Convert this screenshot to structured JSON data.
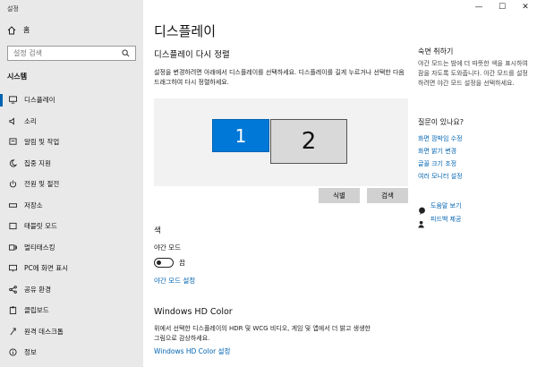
{
  "window": {
    "title": "설정",
    "controls": [
      "—",
      "☐",
      "✕"
    ]
  },
  "sidebar": {
    "home": "홈",
    "search_placeholder": "설정 검색",
    "section": "시스템",
    "items": [
      {
        "label": "디스플레이",
        "icon": "monitor-icon"
      },
      {
        "label": "소리",
        "icon": "speaker-icon"
      },
      {
        "label": "알림 및 작업",
        "icon": "notification-icon"
      },
      {
        "label": "집중 지원",
        "icon": "moon-icon"
      },
      {
        "label": "전원 및 절전",
        "icon": "power-icon"
      },
      {
        "label": "저장소",
        "icon": "storage-icon"
      },
      {
        "label": "태블릿 모드",
        "icon": "tablet-icon"
      },
      {
        "label": "멀티태스킹",
        "icon": "multitask-icon"
      },
      {
        "label": "PC에 화면 표시",
        "icon": "project-icon"
      },
      {
        "label": "공유 환경",
        "icon": "share-icon"
      },
      {
        "label": "클립보드",
        "icon": "clipboard-icon"
      },
      {
        "label": "원격 데스크톱",
        "icon": "remote-desktop-icon"
      },
      {
        "label": "정보",
        "icon": "info-icon"
      }
    ]
  },
  "main": {
    "title": "디스플레이",
    "arrange_title": "디스플레이 다시 정렬",
    "arrange_desc": "설정을 변경하려면 아래에서 디스플레이를 선택하세요. 디스플레이를 길게 누르거나 선택한 다음 드래그하여 다시 정렬하세요.",
    "monitor1": "1",
    "monitor2": "2",
    "identify_label": "식별",
    "detect_label": "검색",
    "color_heading": "색",
    "night_mode_label": "야간 모드",
    "night_mode_state": "끔",
    "night_mode_link": "야간 모드 설정",
    "hdr_title": "Windows HD Color",
    "hdr_desc": "위에서 선택한 디스플레이의 HDR 및 WCG 비디오, 게임 및 앱에서 더 밝고 생생한 그림으로 감상하세요.",
    "hdr_link": "Windows HD Color 설정"
  },
  "right": {
    "sleep_head": "숙면 취하기",
    "sleep_desc": "야간 모드는 밤에 더 따뜻한 색을 표시하여 잠을 자도록 도와줍니다. 야간 모드를 설정하려면 야간 모드 설정을 선택하세요.",
    "qa_head": "질문이 있나요?",
    "links": [
      "화면 깜박임 수정",
      "화면 밝기 변경",
      "글꼴 크기 조정",
      "여러 모니터 설정"
    ],
    "help": "도움말 보기",
    "feedback": "피드백 제공"
  },
  "colors": {
    "accent": "#0078d7",
    "link": "#0063b1",
    "sidebar_bg": "#e9e9e9",
    "preview_bg": "#f2f2f2"
  }
}
